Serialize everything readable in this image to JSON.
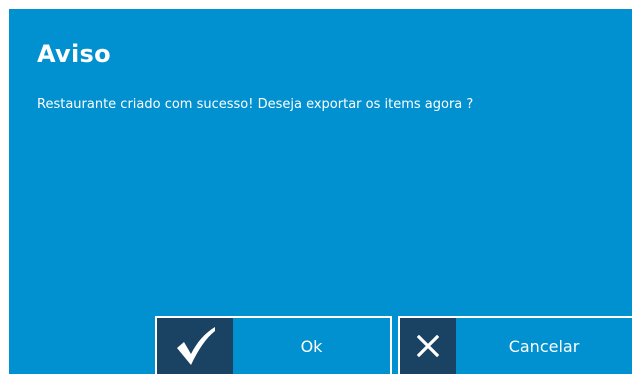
{
  "dialog": {
    "title": "Aviso",
    "message": "Restaurante criado com sucesso! Deseja exportar os items agora ?",
    "background_color": "#0191d0",
    "icon_box_color": "#1a4262"
  },
  "buttons": {
    "ok": {
      "label": "Ok",
      "icon": "checkmark-icon"
    },
    "cancel": {
      "label": "Cancelar",
      "icon": "close-icon"
    }
  }
}
